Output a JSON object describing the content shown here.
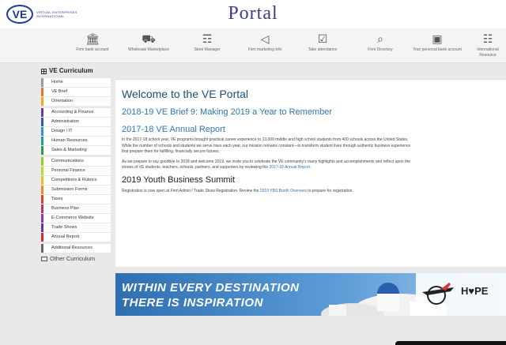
{
  "header": {
    "logo_mark": "VE",
    "logo_text": "VIRTUAL ENTERPRISES INTERNATIONAL",
    "title": "Portal"
  },
  "navbar": {
    "items": [
      {
        "label": "Firm bank account",
        "icon": "bank-icon"
      },
      {
        "label": "Wholesale Marketplace",
        "icon": "truck-icon"
      },
      {
        "label": "Store Manager",
        "icon": "cart-icon"
      },
      {
        "label": "Firm marketing info",
        "icon": "megaphone-icon"
      },
      {
        "label": "Take attendance",
        "icon": "checkbox-icon"
      },
      {
        "label": "Firm Directory",
        "icon": "search-icon"
      },
      {
        "label": "Your personal bank account",
        "icon": "money-icon"
      },
      {
        "label": "International Resource",
        "icon": "document-icon"
      }
    ]
  },
  "sidebar": {
    "heading": "VE Curriculum",
    "groups": [
      {
        "items": [
          {
            "label": "Home",
            "color": "#999999"
          },
          {
            "label": "VE Brief",
            "color": "#e8742a"
          },
          {
            "label": "Orientation",
            "color": "#f5a623"
          }
        ]
      },
      {
        "items": [
          {
            "label": "Accounting & Finance",
            "color": "#6a3d9a"
          },
          {
            "label": "Administration",
            "color": "#2a5cb3"
          },
          {
            "label": "Design / IT",
            "color": "#3a8fd1"
          },
          {
            "label": "Human Resources",
            "color": "#1ca58f"
          },
          {
            "label": "Sales & Marketing",
            "color": "#2e9e3e"
          }
        ]
      },
      {
        "items": [
          {
            "label": "Communications",
            "color": "#9acd32"
          },
          {
            "label": "Personal Finance",
            "color": "#c8d62a"
          },
          {
            "label": "Competitions & Rubrics",
            "color": "#e8c020"
          },
          {
            "label": "Submission Forms",
            "color": "#f08a24"
          },
          {
            "label": "Taxes",
            "color": "#e04030"
          },
          {
            "label": "Business Plan",
            "color": "#c0306a"
          },
          {
            "label": "E-Commerce Website",
            "color": "#8e3aa8"
          },
          {
            "label": "Trade Shows",
            "color": "#5a3aa8"
          },
          {
            "label": "Annual Report",
            "color": "#d92a2a"
          }
        ]
      },
      {
        "items": [
          {
            "label": "Additional Resources",
            "color": "#666666"
          }
        ]
      }
    ],
    "other": "Other Curriculum"
  },
  "main": {
    "welcome": "Welcome to the VE Portal",
    "brief_title": "2018-19 VE Brief 9: Making 2019 a Year to Remember",
    "annual_title": "2017-18 VE Annual Report",
    "para1_line1": "In the 2017-18 school year, VE programs brought practical career experience to 13,000 middle and high school students from 400 schools across the United States.",
    "para1_line2": "While the number of schools and students we serve rises each year, our mission remains constant—to transform student lives through authentic business experience",
    "para1_line3": "that prepare them for fulfilling, financially secure futures.",
    "para2_line1": "As we prepare to say goodbye to 2018 and welcome 2019, we invite you to celebrate the VE community's many highlights and accomplishments and reflect upon the",
    "para2_line2_pre": "stories of VE students, teachers, schools, partners, and supporters by reviewing the ",
    "para2_link": "2017-18 Annual Report",
    "para2_line2_post": ".",
    "summit_title": "2019 Youth Business Summit",
    "summit_pre": "Registration is now open at Firm Admin / Trade Show Registration. Review the ",
    "summit_link": "2019 YBS Booth Overview",
    "summit_post": " to prepare for registration."
  },
  "banner": {
    "line1": "WITHIN EVERY DESTINATION",
    "line2": "THERE IS INSPIRATION",
    "hope": "H♥PE"
  }
}
